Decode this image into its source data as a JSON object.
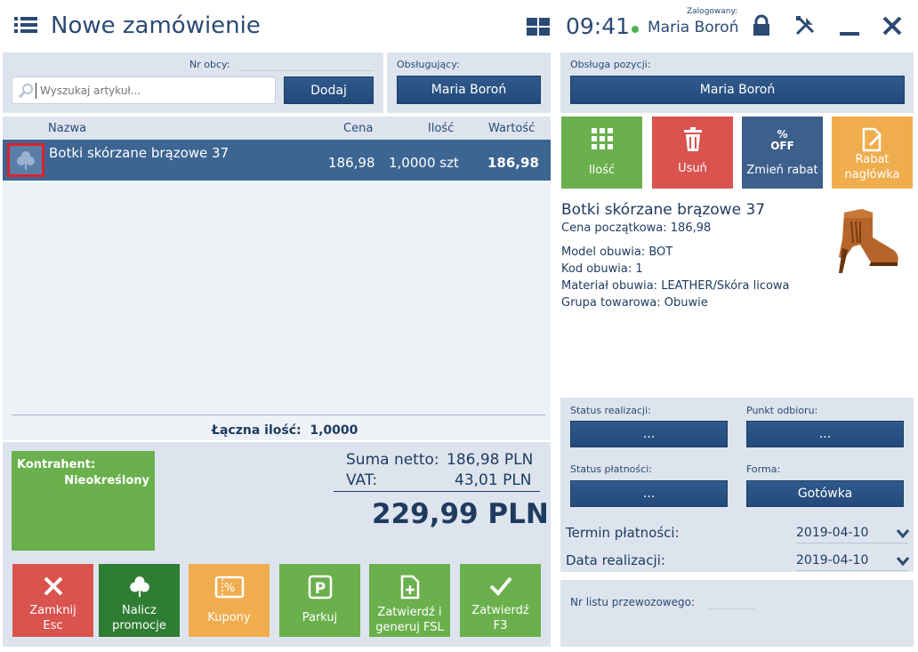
{
  "header": {
    "title": "Nowe zamówienie",
    "time": "09:41",
    "logged_label": "Zalogowany:",
    "user": "Maria Boroń"
  },
  "left_top": {
    "nr_obcy_label": "Nr obcy:",
    "search_placeholder": "Wyszukaj artykuł...",
    "add_button": "Dodaj",
    "obslugujacy_label": "Obsługujący:",
    "obslugujacy_value": "Maria Boroń"
  },
  "table": {
    "columns": [
      "Nazwa",
      "Cena",
      "Ilość",
      "Wartość"
    ],
    "rows": [
      {
        "name": "Botki skórzane brązowe 37",
        "price": "186,98",
        "qty": "1,0000 szt",
        "value": "186,98"
      }
    ]
  },
  "totals": {
    "qty_label": "Łączna ilość:",
    "qty_value": "1,0000",
    "netto_label": "Suma netto:",
    "netto_value": "186,98 PLN",
    "vat_label": "VAT:",
    "vat_value": "43,01 PLN",
    "grand_total": "229,99 PLN"
  },
  "kontrahent": {
    "label": "Kontrahent:",
    "value": "Nieokreślony"
  },
  "bottom_buttons": [
    {
      "line1": "Zamknij",
      "line2": "Esc",
      "color": "#d9534f"
    },
    {
      "line1": "Nalicz",
      "line2": "promocje",
      "color": "#2e7d32"
    },
    {
      "line1": "Kupony",
      "line2": "",
      "color": "#f0ad4e"
    },
    {
      "line1": "Parkuj",
      "line2": "",
      "color": "#6ab04c"
    },
    {
      "line1": "Zatwierdź i",
      "line2": "generuj FSL",
      "color": "#6ab04c"
    },
    {
      "line1": "Zatwierdź",
      "line2": "F3",
      "color": "#6ab04c"
    }
  ],
  "right_top": {
    "obsluga_label": "Obsługa pozycji:",
    "obsluga_value": "Maria Boroń"
  },
  "action_buttons": [
    {
      "line1": "Ilość",
      "line2": "",
      "color": "#6ab04c"
    },
    {
      "line1": "Usuń",
      "line2": "",
      "color": "#d9534f"
    },
    {
      "line1": "Zmień rabat",
      "line2": "",
      "color": "#3d5f8c"
    },
    {
      "line1": "Rabat",
      "line2": "nagłówka",
      "color": "#f0ad4e"
    }
  ],
  "product": {
    "title": "Botki skórzane brązowe 37",
    "cena_poczatkowa": "Cena początkowa: 186,98",
    "model": "Model obuwia: BOT",
    "kod": "Kod obuwia: 1",
    "material": "Materiał obuwia: LEATHER/Skóra licowa",
    "grupa": "Grupa towarowa: Obuwie"
  },
  "order_details": {
    "status_realizacji_label": "Status realizacji:",
    "status_realizacji_value": "...",
    "punkt_odbioru_label": "Punkt odbioru:",
    "punkt_odbioru_value": "...",
    "status_platnosci_label": "Status płatności:",
    "status_platnosci_value": "...",
    "forma_label": "Forma:",
    "forma_value": "Gotówka",
    "termin_label": "Termin płatności:",
    "termin_value": "2019-04-10",
    "data_real_label": "Data realizacji:",
    "data_real_value": "2019-04-10",
    "nr_listu_label": "Nr listu przewozowego:"
  },
  "off_badge": "%\nOFF"
}
